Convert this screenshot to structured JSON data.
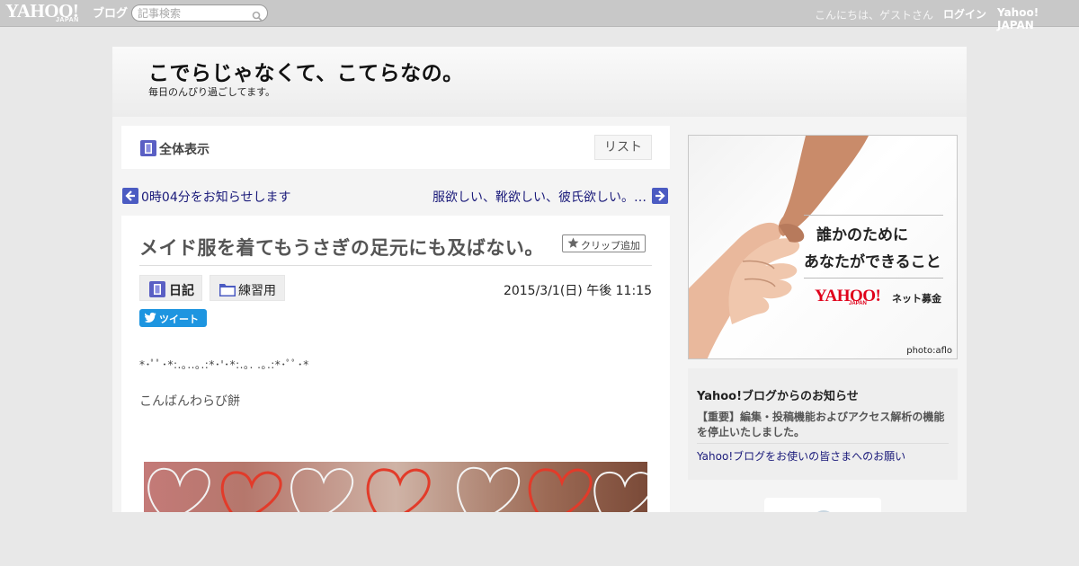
{
  "topbar": {
    "logo": "YAHOO!",
    "logo_sub": "JAPAN",
    "logo_blog": "ブログ",
    "search_placeholder": "記事検索",
    "greeting": "こんにちは、ゲストさん",
    "login": "ログイン",
    "yahoo_japan": "Yahoo! JAPAN"
  },
  "blog": {
    "title": "こでらじゃなくて、こてらなの。",
    "description": "毎日のんびり過ごしてます。"
  },
  "toolbar": {
    "all_view": "全体表示",
    "list": "リスト"
  },
  "pager": {
    "prev": "0時04分をお知らせします",
    "next": "服欲しい、靴欲しい、彼氏欲しい。…"
  },
  "article": {
    "title": "メイド服を着てもうさぎの足元にも及ばない。",
    "clip": "クリップ追加",
    "category": "日記",
    "folder": "練習用",
    "date": "2015/3/1(日) 午後 11:15",
    "tweet": "ツイート",
    "decoration": "*･ﾟﾟ･*:.｡..｡.:*･'･*:.｡. .｡.:*･ﾟﾟ･*",
    "body": "こんばんわらび餅"
  },
  "ad": {
    "line1": "誰かのために",
    "line2": "あなたができること",
    "brand": "YAHOO!",
    "brand_sub": "JAPAN",
    "service": "ネット募金",
    "credit": "photo:aflo"
  },
  "notice": {
    "title": "Yahoo!ブログからのお知らせ",
    "item1": "【重要】編集・投稿機能およびアクセス解析の機能を停止いたしました。",
    "item2": "Yahoo!ブログをお使いの皆さまへのお願い"
  },
  "colors": {
    "topbar_bg": "#c8c8c8",
    "link": "#1a1a7a",
    "arrow": "#4b5bc2",
    "tweet": "#1d95e0",
    "brand_red": "#e0001a"
  }
}
